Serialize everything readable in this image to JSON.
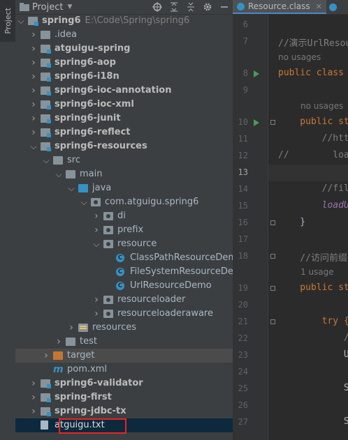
{
  "sidebar_tab": "Project",
  "panel": {
    "title": "Project"
  },
  "tree": [
    {
      "label": "spring6",
      "path": "E:\\Code\\Spring\\spring6",
      "bold": true,
      "depth": 0,
      "arrow": "open",
      "icon": "module"
    },
    {
      "label": ".idea",
      "depth": 1,
      "arrow": "closed",
      "icon": "folder"
    },
    {
      "label": "atguigu-spring",
      "bold": true,
      "depth": 1,
      "arrow": "closed",
      "icon": "module"
    },
    {
      "label": "spring6-aop",
      "bold": true,
      "depth": 1,
      "arrow": "closed",
      "icon": "module"
    },
    {
      "label": "spring6-i18n",
      "bold": true,
      "depth": 1,
      "arrow": "closed",
      "icon": "module"
    },
    {
      "label": "spring6-ioc-annotation",
      "bold": true,
      "depth": 1,
      "arrow": "closed",
      "icon": "module"
    },
    {
      "label": "spring6-ioc-xml",
      "bold": true,
      "depth": 1,
      "arrow": "closed",
      "icon": "module"
    },
    {
      "label": "spring6-junit",
      "bold": true,
      "depth": 1,
      "arrow": "closed",
      "icon": "module"
    },
    {
      "label": "spring6-reflect",
      "bold": true,
      "depth": 1,
      "arrow": "closed",
      "icon": "module"
    },
    {
      "label": "spring6-resources",
      "bold": true,
      "depth": 1,
      "arrow": "open",
      "icon": "module"
    },
    {
      "label": "src",
      "depth": 2,
      "arrow": "open",
      "icon": "folder"
    },
    {
      "label": "main",
      "depth": 3,
      "arrow": "open",
      "icon": "folder"
    },
    {
      "label": "java",
      "depth": 4,
      "arrow": "open",
      "icon": "src"
    },
    {
      "label": "com.atguigu.spring6",
      "depth": 5,
      "arrow": "open",
      "icon": "package"
    },
    {
      "label": "di",
      "depth": 6,
      "arrow": "closed",
      "icon": "package"
    },
    {
      "label": "prefix",
      "depth": 6,
      "arrow": "closed",
      "icon": "package"
    },
    {
      "label": "resource",
      "depth": 6,
      "arrow": "open",
      "icon": "package"
    },
    {
      "label": "ClassPathResourceDemo",
      "depth": 7,
      "arrow": "none",
      "icon": "class"
    },
    {
      "label": "FileSystemResourceDemo",
      "depth": 7,
      "arrow": "none",
      "icon": "class"
    },
    {
      "label": "UrlResourceDemo",
      "depth": 7,
      "arrow": "none",
      "icon": "class"
    },
    {
      "label": "resourceloader",
      "depth": 6,
      "arrow": "closed",
      "icon": "package"
    },
    {
      "label": "resourceloaderaware",
      "depth": 6,
      "arrow": "closed",
      "icon": "package"
    },
    {
      "label": "resources",
      "depth": 4,
      "arrow": "closed",
      "icon": "resources"
    },
    {
      "label": "test",
      "depth": 3,
      "arrow": "closed",
      "icon": "folder"
    },
    {
      "label": "target",
      "depth": 2,
      "arrow": "closed",
      "icon": "target",
      "state": "sel-light"
    },
    {
      "label": "pom.xml",
      "depth": 2,
      "arrow": "none",
      "icon": "maven"
    },
    {
      "label": "spring6-validator",
      "bold": true,
      "depth": 1,
      "arrow": "closed",
      "icon": "module"
    },
    {
      "label": "spring-first",
      "bold": true,
      "depth": 1,
      "arrow": "closed",
      "icon": "module"
    },
    {
      "label": "spring-jdbc-tx",
      "bold": true,
      "depth": 1,
      "arrow": "closed",
      "icon": "module"
    },
    {
      "label": "atguigu.txt",
      "depth": 1,
      "arrow": "none",
      "icon": "text",
      "state": "sel"
    }
  ],
  "editor": {
    "tab_label": "Resource.class",
    "lines": [
      {
        "n": "6",
        "code": ""
      },
      {
        "n": "7",
        "code": "//演示UrlResou",
        "cls": "cm"
      },
      {
        "hint": "no usages"
      },
      {
        "n": "8",
        "code": "public class",
        "cls": "kw",
        "run": true
      },
      {
        "n": "9",
        "code": ""
      },
      {
        "hint": "no usages",
        "indent": 4
      },
      {
        "n": "10",
        "code": "    public st",
        "cls": "kw",
        "run": true,
        "fold": true
      },
      {
        "n": "11",
        "code": "        //htt",
        "cls": "cm"
      },
      {
        "n": "12",
        "code": "//        loa",
        "cls": "cm"
      },
      {
        "n": "13",
        "code": "",
        "current": true
      },
      {
        "n": "14",
        "code": "        //fil",
        "cls": "cm"
      },
      {
        "n": "15",
        "code": "        loadU",
        "cls": "it"
      },
      {
        "n": "16",
        "code": "    }",
        "fold": true
      },
      {
        "n": "17",
        "code": ""
      },
      {
        "n": "18",
        "code": "    //访问前缀",
        "cls": "cm",
        "fold": true
      },
      {
        "hint": "1 usage",
        "indent": 4
      },
      {
        "n": "19",
        "code": "    public st",
        "cls": "kw",
        "fold": true
      },
      {
        "n": "20",
        "code": ""
      },
      {
        "n": "21",
        "code": "        try {",
        "cls": "kw",
        "fold": true
      },
      {
        "n": "22",
        "code": "            /",
        "cls": "cm"
      },
      {
        "n": "23",
        "code": "            U"
      },
      {
        "n": "24",
        "code": ""
      },
      {
        "n": "25",
        "code": "            S"
      },
      {
        "n": "26",
        "code": ""
      },
      {
        "n": "27",
        "code": "            S"
      }
    ]
  }
}
